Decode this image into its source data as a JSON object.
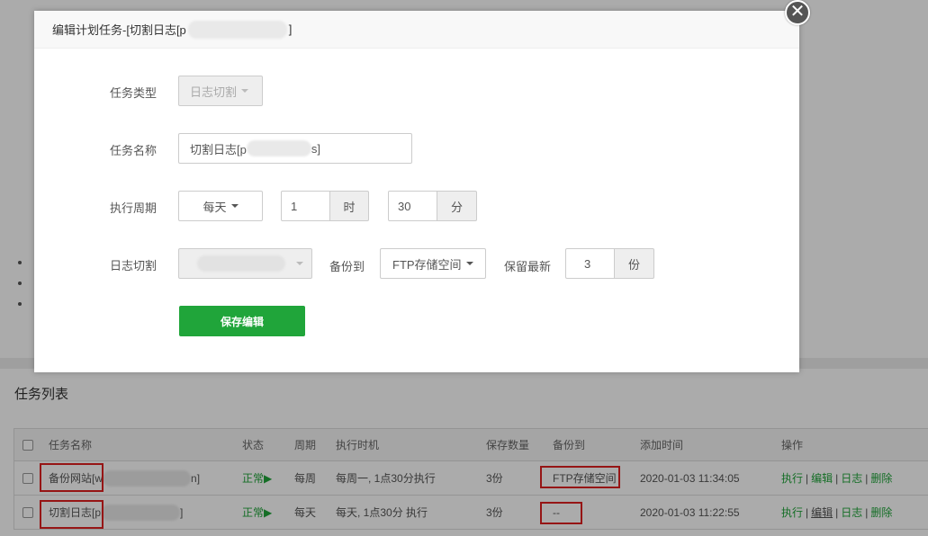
{
  "dialog": {
    "title_prefix": "编辑计划任务-[切割日志[p",
    "title_suffix": "]",
    "close_glyph": "✕",
    "fields": {
      "task_type_label": "任务类型",
      "task_type_value": "日志切割",
      "task_name_label": "任务名称",
      "task_name_prefix": "切割日志[p",
      "task_name_suffix": "s]",
      "period_label": "执行周期",
      "period_value": "每天",
      "hour_value": "1",
      "hour_unit": "时",
      "minute_value": "30",
      "minute_unit": "分",
      "log_cut_label": "日志切割",
      "backup_to_label": "备份到",
      "backup_to_value": "FTP存储空间",
      "keep_latest_label": "保留最新",
      "keep_value": "3",
      "keep_unit": "份"
    },
    "save_button": "保存编辑"
  },
  "task_list": {
    "title": "任务列表",
    "columns": [
      "任务名称",
      "状态",
      "周期",
      "执行时机",
      "保存数量",
      "备份到",
      "添加时间",
      "操作"
    ],
    "rows": [
      {
        "name_prefix": "备份网站[w",
        "name_suffix": "n]",
        "status": "正常▶",
        "period": "每周",
        "timing": "每周一, 1点30分执行",
        "keep": "3份",
        "backup_to": "FTP存储空间",
        "added": "2020-01-03 11:34:05",
        "actions": [
          "执行",
          "编辑",
          "日志",
          "删除"
        ]
      },
      {
        "name_prefix": "切割日志[p",
        "name_suffix": "]",
        "status": "正常▶",
        "period": "每天",
        "timing": "每天, 1点30分 执行",
        "keep": "3份",
        "backup_to": "--",
        "added": "2020-01-03 11:22:55",
        "actions": [
          "执行",
          "编辑",
          "日志",
          "删除"
        ]
      }
    ]
  },
  "colors": {
    "accent_green": "#20a53a",
    "highlight_red": "#e02020",
    "overlay": "rgba(0,0,0,0.33)"
  },
  "icons": {
    "close": "close-icon",
    "dropdown": "caret-down-icon",
    "status_play": "play-icon"
  }
}
